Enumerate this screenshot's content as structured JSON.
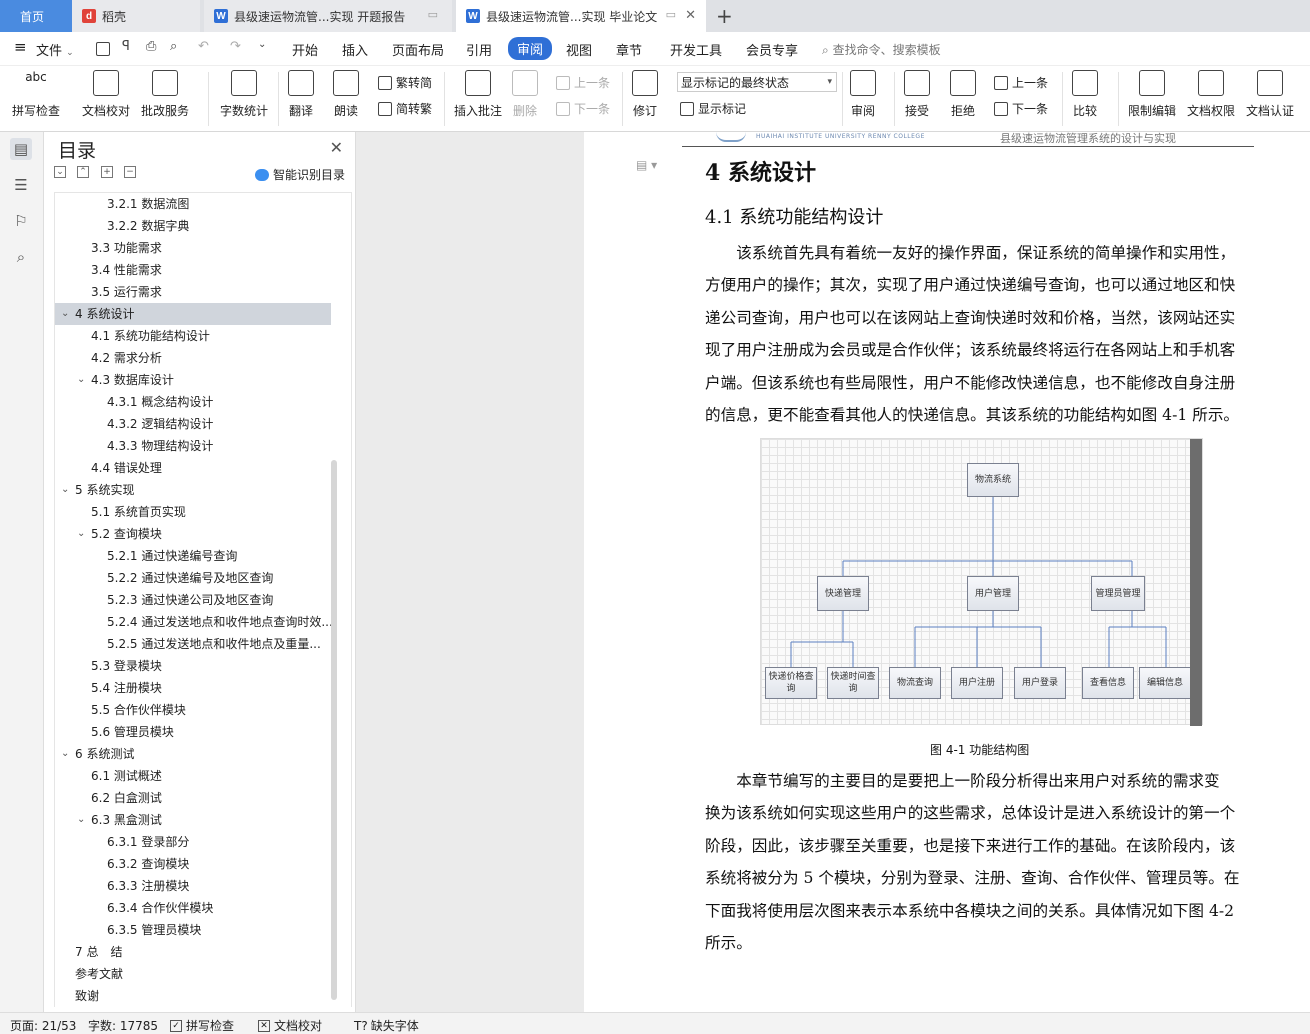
{
  "tabs": [
    {
      "label": "首页",
      "active": true
    },
    {
      "label": "稻壳"
    },
    {
      "label": "县级速运物流管...实现 开题报告"
    },
    {
      "label": "县级速运物流管...实现 毕业论文",
      "current": true
    }
  ],
  "menu": {
    "file": "文件",
    "items": [
      "开始",
      "插入",
      "页面布局",
      "引用",
      "审阅",
      "视图",
      "章节",
      "开发工具",
      "会员专享"
    ],
    "active": "审阅",
    "search_placeholder": "查找命令、搜索模板"
  },
  "ribbon": {
    "spell_check": "拼写检查",
    "doc_proof": "文档校对",
    "batch_service": "批改服务",
    "word_count": "字数统计",
    "translate": "翻译",
    "read_aloud": "朗读",
    "trad_to_simp": "繁转简",
    "simp_to_trad": "简转繁",
    "insert_comment": "插入批注",
    "delete": "删除",
    "prev_comment": "上一条",
    "next_comment": "下一条",
    "revise": "修订",
    "markup_select": "显示标记的最终状态",
    "show_markup": "显示标记",
    "review": "审阅",
    "accept": "接受",
    "reject": "拒绝",
    "prev_change": "上一条",
    "next_change": "下一条",
    "compare": "比较",
    "restrict_edit": "限制编辑",
    "doc_permission": "文档权限",
    "doc_auth": "文档认证"
  },
  "nav": {
    "title": "目录",
    "smart_toc": "智能识别目录",
    "items": [
      {
        "label": "3.2.1 数据流图",
        "level": 3
      },
      {
        "label": "3.2.2 数据字典",
        "level": 3
      },
      {
        "label": "3.3 功能需求",
        "level": 2
      },
      {
        "label": "3.4 性能需求",
        "level": 2
      },
      {
        "label": "3.5 运行需求",
        "level": 2
      },
      {
        "label": "4 系统设计",
        "level": 1,
        "expanded": true,
        "selected": true
      },
      {
        "label": "4.1 系统功能结构设计",
        "level": 2
      },
      {
        "label": "4.2 需求分析",
        "level": 2
      },
      {
        "label": "4.3 数据库设计",
        "level": 2,
        "expanded": true
      },
      {
        "label": "4.3.1 概念结构设计",
        "level": 3
      },
      {
        "label": "4.3.2 逻辑结构设计",
        "level": 3
      },
      {
        "label": "4.3.3 物理结构设计",
        "level": 3
      },
      {
        "label": "4.4 错误处理",
        "level": 2
      },
      {
        "label": "5 系统实现",
        "level": 1,
        "expanded": true
      },
      {
        "label": "5.1 系统首页实现",
        "level": 2
      },
      {
        "label": "5.2 查询模块",
        "level": 2,
        "expanded": true
      },
      {
        "label": "5.2.1 通过快递编号查询",
        "level": 3
      },
      {
        "label": "5.2.2 通过快递编号及地区查询",
        "level": 3
      },
      {
        "label": "5.2.3 通过快递公司及地区查询",
        "level": 3
      },
      {
        "label": "5.2.4 通过发送地点和收件地点查询时效...",
        "level": 3
      },
      {
        "label": "5.2.5 通过发送地点和收件地点及重量...",
        "level": 3
      },
      {
        "label": "5.3 登录模块",
        "level": 2
      },
      {
        "label": "5.4 注册模块",
        "level": 2
      },
      {
        "label": "5.5 合作伙伴模块",
        "level": 2
      },
      {
        "label": "5.6 管理员模块",
        "level": 2
      },
      {
        "label": "6 系统测试",
        "level": 1,
        "expanded": true
      },
      {
        "label": "6.1 测试概述",
        "level": 2
      },
      {
        "label": "6.2 白盒测试",
        "level": 2
      },
      {
        "label": "6.3 黑盒测试",
        "level": 2,
        "expanded": true
      },
      {
        "label": "6.3.1 登录部分",
        "level": 3
      },
      {
        "label": "6.3.2 查询模块",
        "level": 3
      },
      {
        "label": "6.3.3 注册模块",
        "level": 3
      },
      {
        "label": "6.3.4 合作伙伴模块",
        "level": 3
      },
      {
        "label": "6.3.5 管理员模块",
        "level": 3
      },
      {
        "label": "7 总　结",
        "level": 1
      },
      {
        "label": "参考文献",
        "level": 1
      },
      {
        "label": "致谢",
        "level": 1
      }
    ]
  },
  "document": {
    "header_text": "县级速运物流管理系统的设计与实现",
    "header_logo_text": "HUAIHAI INSTITUTE UNIVERSITY RENNY COLLEGE",
    "h1": "4 系统设计",
    "h2": "4.1 系统功能结构设计",
    "para1_lines": [
      "　　该系统首先具有着统一友好的操作界面，保证系统的简单操作和实用性，",
      "方便用户的操作；其次，实现了用户通过快递编号查询，也可以通过地区和快",
      "递公司查询，用户也可以在该网站上查询快递时效和价格，当然，该网站还实",
      "现了用户注册成为会员或是合作伙伴；该系统最终将运行在各网站上和手机客",
      "户端。但该系统也有些局限性，用户不能修改快递信息，也不能修改自身注册",
      "的信息，更不能查看其他人的快递信息。其该系统的功能结构如图 4-1 所示。"
    ],
    "figure": {
      "root": "物流系统",
      "groups": [
        {
          "name": "快递管理",
          "children": [
            "快递价格查询",
            "快递时间查询"
          ]
        },
        {
          "name": "用户管理",
          "children": [
            "物流查询",
            "用户注册",
            "用户登录"
          ]
        },
        {
          "name": "管理员管理",
          "children": [
            "查看信息",
            "编辑信息"
          ]
        }
      ],
      "caption": "图 4-1  功能结构图"
    },
    "para2_lines": [
      "　　本章节编写的主要目的是要把上一阶段分析得出来用户对系统的需求变",
      "换为该系统如何实现这些用户的这些需求，总体设计是进入系统设计的第一个",
      "阶段，因此，该步骤至关重要，也是接下来进行工作的基础。在该阶段内，该",
      "系统将被分为 5 个模块，分别为登录、注册、查询、合作伙伴、管理员等。在",
      "下面我将使用层次图来表示本系统中各模块之间的关系。具体情况如下图 4-2",
      "所示。"
    ]
  },
  "status": {
    "page": "页面: 21/53",
    "words": "字数: 17785",
    "spell": "拼写检查",
    "proof": "文档校对",
    "missing_font": "缺失字体"
  },
  "colors": {
    "accent": "#2f6fd6",
    "tab_home": "#3b82d8",
    "selection": "#d0d5dc"
  }
}
